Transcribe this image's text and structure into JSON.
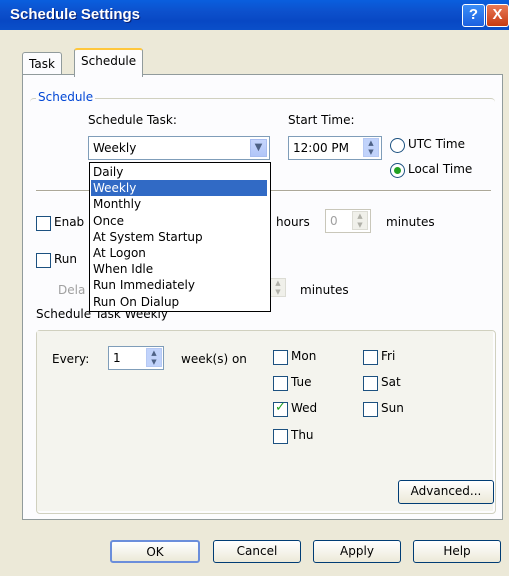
{
  "window": {
    "title": "Schedule Settings",
    "help_glyph": "?",
    "close_glyph": "X"
  },
  "tabs": [
    {
      "label": "Task"
    },
    {
      "label": "Schedule"
    }
  ],
  "schedule_group": {
    "label": "Schedule",
    "schedule_task_label": "Schedule Task:",
    "schedule_task_value": "Weekly",
    "start_time_label": "Start Time:",
    "start_time_value": "12:00 PM",
    "utc_label": "UTC Time",
    "local_label": "Local Time",
    "time_mode": "Local Time"
  },
  "dropdown_options": [
    "Daily",
    "Weekly",
    "Monthly",
    "Once",
    "At System Startup",
    "At Logon",
    "When Idle",
    "Run Immediately",
    "Run On Dialup"
  ],
  "dropdown_selected": "Weekly",
  "enable_row": {
    "label_visible": "Enab",
    "hours_label": "hours",
    "minutes_value": "0",
    "minutes_label": "minutes",
    "checked": false
  },
  "run_row": {
    "label_visible": "Run",
    "checked": false
  },
  "delay_row": {
    "label_visible": "Dela",
    "minutes_label": "minutes"
  },
  "weekly_group": {
    "label": "Schedule Task Weekly",
    "every_label": "Every:",
    "every_value": "1",
    "weeks_label": "week(s) on",
    "days": [
      {
        "label": "Mon",
        "checked": false
      },
      {
        "label": "Tue",
        "checked": false
      },
      {
        "label": "Wed",
        "checked": true
      },
      {
        "label": "Thu",
        "checked": false
      },
      {
        "label": "Fri",
        "checked": false
      },
      {
        "label": "Sat",
        "checked": false
      },
      {
        "label": "Sun",
        "checked": false
      }
    ],
    "advanced_label": "Advanced..."
  },
  "buttons": {
    "ok": "OK",
    "cancel": "Cancel",
    "apply": "Apply",
    "help": "Help"
  }
}
